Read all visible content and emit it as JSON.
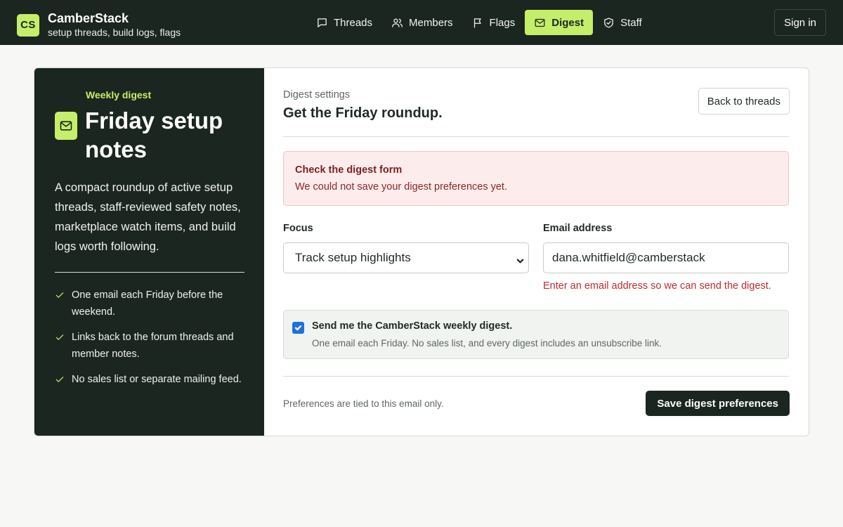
{
  "header": {
    "logo_text": "CS",
    "brand_name": "CamberStack",
    "tagline": "setup threads, build logs, flags",
    "nav": [
      {
        "label": "Threads",
        "icon": "chat-bubble-icon",
        "active": false
      },
      {
        "label": "Members",
        "icon": "users-icon",
        "active": false
      },
      {
        "label": "Flags",
        "icon": "flag-icon",
        "active": false
      },
      {
        "label": "Digest",
        "icon": "mail-icon",
        "active": true
      },
      {
        "label": "Staff",
        "icon": "shield-check-icon",
        "active": false
      }
    ],
    "signin_label": "Sign in"
  },
  "sidebar": {
    "eyebrow": "Weekly digest",
    "title": "Friday setup notes",
    "description": "A compact roundup of active setup threads, staff-reviewed safety notes, marketplace watch items, and build logs worth following.",
    "perks": [
      "One email each Friday before the weekend.",
      "Links back to the forum threads and member notes.",
      "No sales list or separate mailing feed."
    ]
  },
  "form": {
    "kicker": "Digest settings",
    "title": "Get the Friday roundup.",
    "back_label": "Back to threads",
    "alert": {
      "title": "Check the digest form",
      "text": "We could not save your digest preferences yet."
    },
    "focus_label": "Focus",
    "focus_value": "Track setup highlights",
    "email_label": "Email address",
    "email_value": "dana.whitfield@camberstack",
    "email_error": "Enter an email address so we can send the digest.",
    "optin": {
      "checked": true,
      "title": "Send me the CamberStack weekly digest.",
      "description": "One email each Friday. No sales list, and every digest includes an unsubscribe link."
    },
    "footnote": "Preferences are tied to this email only.",
    "save_label": "Save digest preferences"
  },
  "colors": {
    "brand_dark": "#1c2620",
    "accent_lime": "#c5ee6a",
    "error_red": "#c12b2b",
    "checkbox_blue": "#1f6fe0"
  }
}
